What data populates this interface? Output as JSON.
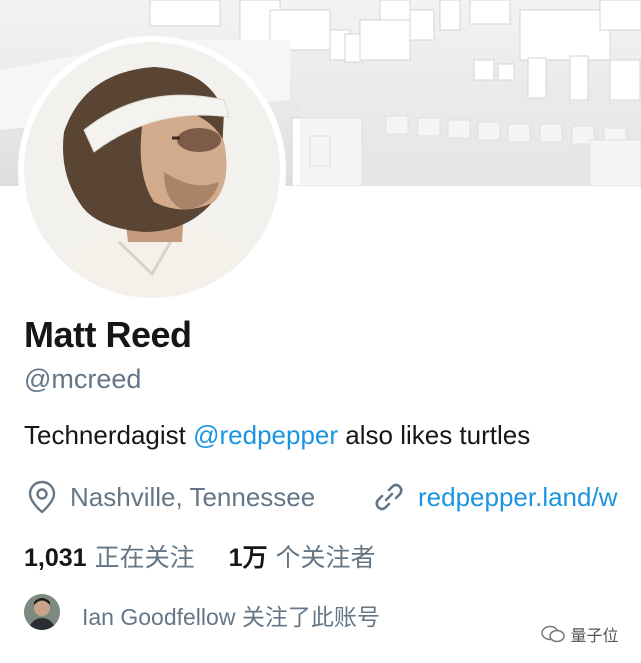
{
  "profile": {
    "name": "Matt Reed",
    "handle": "@mcreed",
    "bio_prefix": "Technerdagist ",
    "bio_mention": "@redpepper",
    "bio_suffix": " also likes turtles",
    "location": "Nashville, Tennessee",
    "website": "redpepper.land/w"
  },
  "stats": {
    "following_count": "1,031",
    "following_label": "正在关注",
    "followers_count": "1万",
    "followers_label": "个关注者"
  },
  "followed_by": {
    "text": "Ian Goodfellow 关注了此账号"
  },
  "watermark": {
    "text": "量子位"
  },
  "icons": {
    "location": "location-pin-icon",
    "link": "link-icon"
  },
  "colors": {
    "primary_text": "#14171a",
    "secondary_text": "#657786",
    "link": "#1b95e0"
  }
}
